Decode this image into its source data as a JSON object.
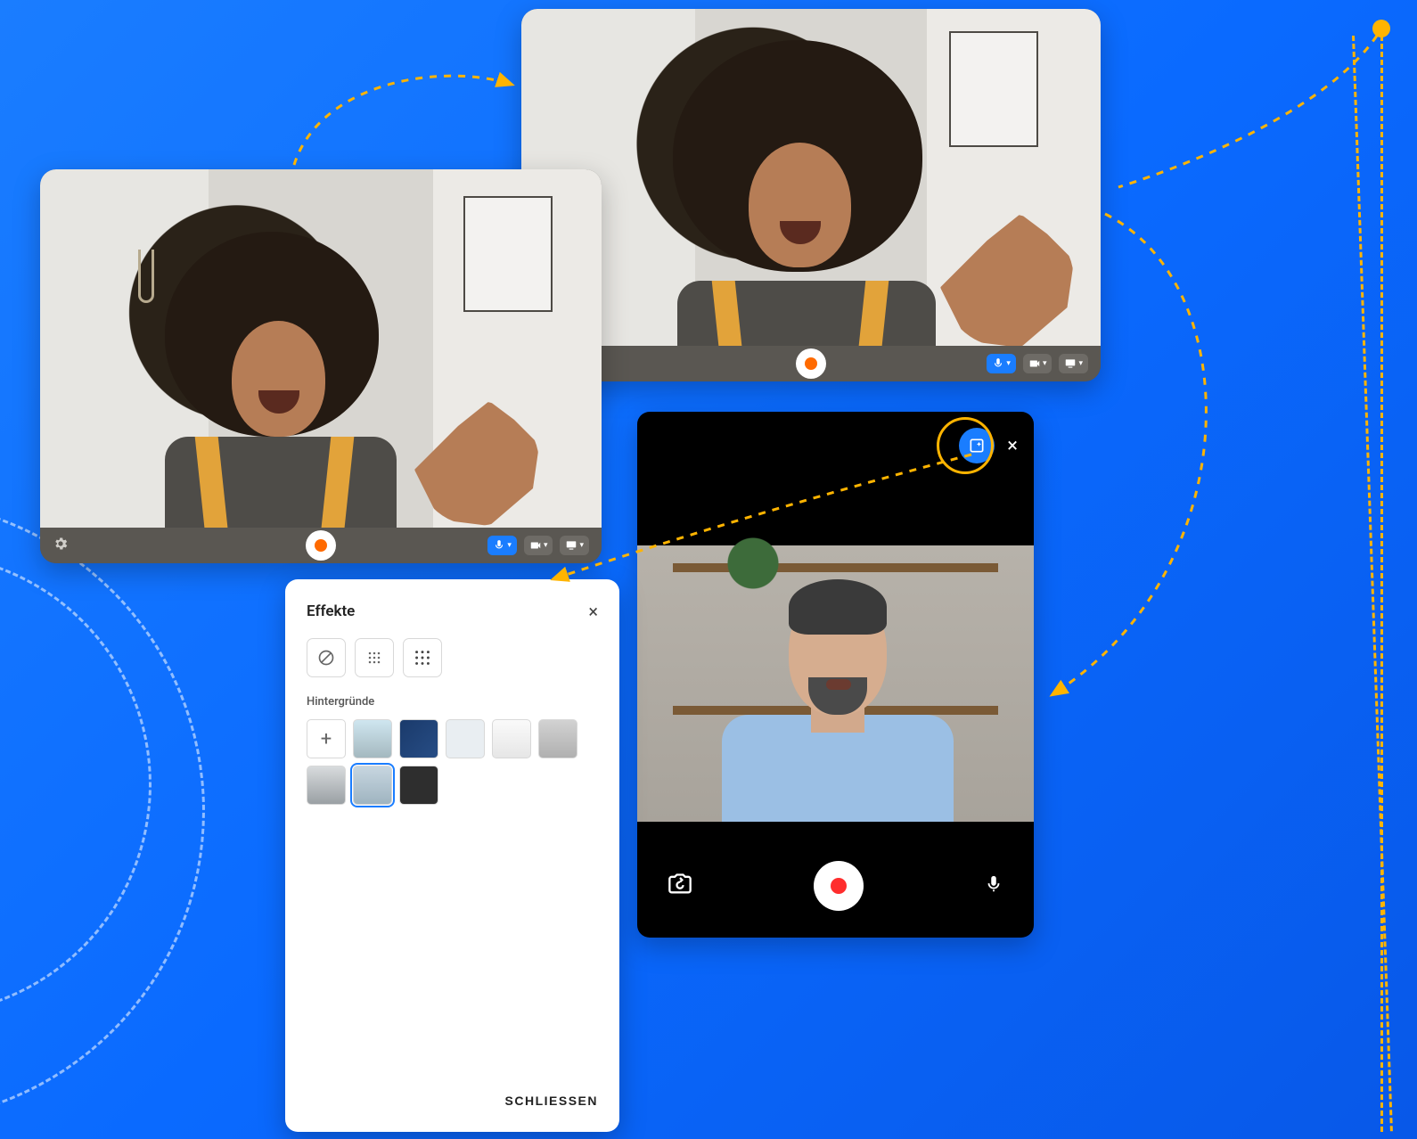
{
  "webcam_a": {
    "icons": {
      "settings": "gear",
      "mic": "microphone",
      "camera": "camera",
      "screen": "monitor"
    }
  },
  "webcam_b": {
    "icons": {
      "mic": "microphone",
      "camera": "camera",
      "screen": "monitor"
    }
  },
  "mobile_recorder": {
    "icons": {
      "effects": "sparkle-frame",
      "close": "×",
      "switch_camera": "switch-camera",
      "mic": "microphone"
    }
  },
  "effects_panel": {
    "title": "Effekte",
    "section_backgrounds": "Hintergründe",
    "close_button": "SCHLIESSEN",
    "add_symbol": "+",
    "close_symbol": "×"
  }
}
